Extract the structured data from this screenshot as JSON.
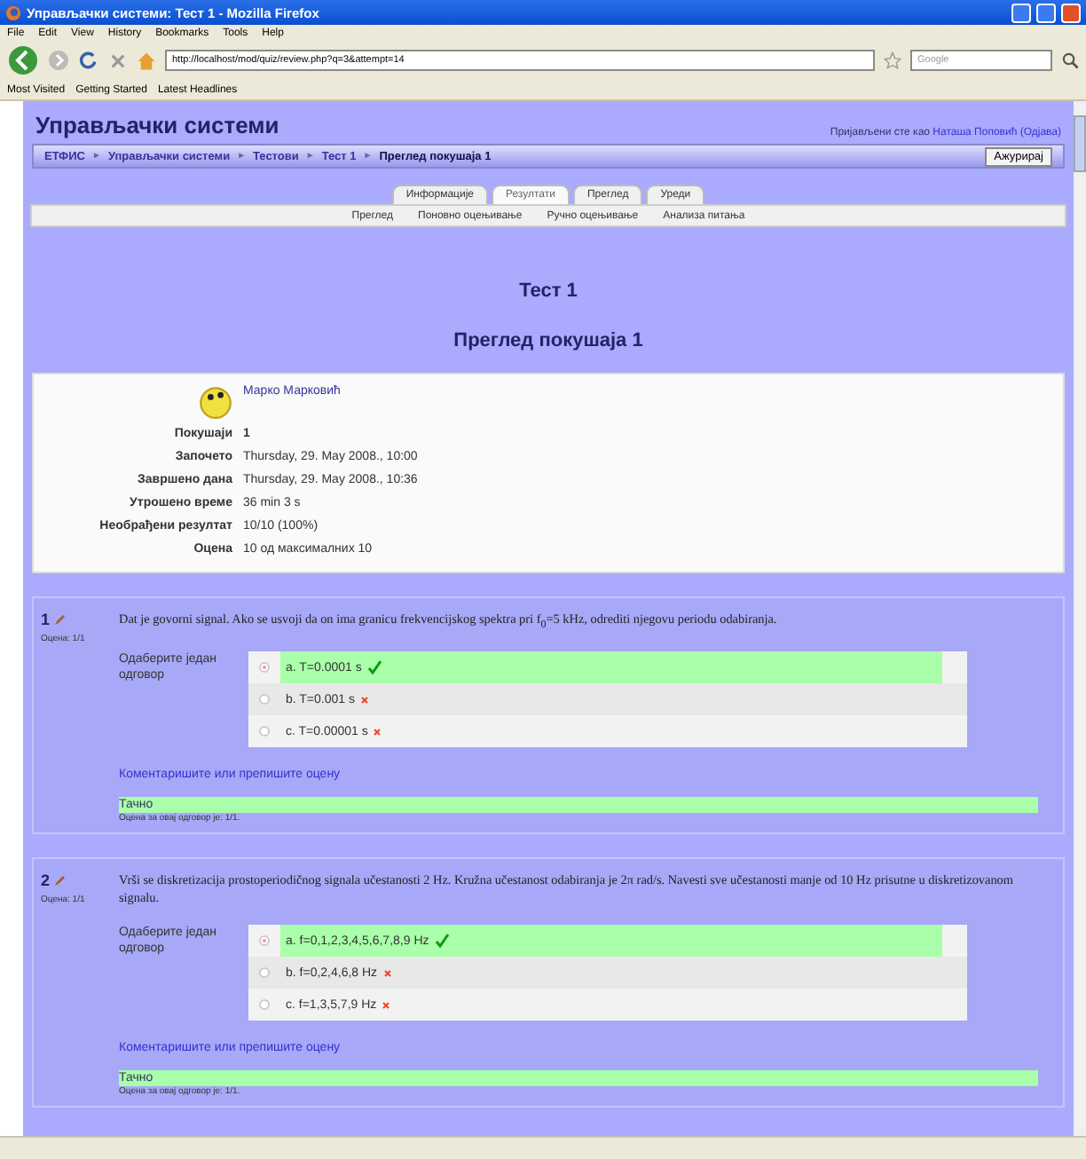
{
  "window": {
    "title": "Управљачки системи: Тест 1 - Mozilla Firefox"
  },
  "menu": [
    "File",
    "Edit",
    "View",
    "History",
    "Bookmarks",
    "Tools",
    "Help"
  ],
  "address": {
    "value": "http://localhost/mod/quiz/review.php?q=3&attempt=14"
  },
  "search": {
    "placeholder": "Google"
  },
  "bookmarks": [
    "Most Visited",
    "Getting Started",
    "Latest Headlines"
  ],
  "header": {
    "site": "Управљачки системи",
    "login_text": "Пријављени сте као",
    "user": "Наташа Поповић",
    "logout": "(Одјава)"
  },
  "breadcrumb": {
    "separator": "►",
    "items": [
      "ЕТФИС",
      "Управљачки системи",
      "Тестови",
      "Тест 1"
    ],
    "current": "Преглед покушаја 1",
    "button": "Ажурирај"
  },
  "tabs": [
    {
      "label": "Информације",
      "selected": false
    },
    {
      "label": "Резултати",
      "selected": true
    },
    {
      "label": "Преглед",
      "selected": false
    },
    {
      "label": "Уреди",
      "selected": false
    }
  ],
  "subtabs": [
    "Преглед",
    "Поновно оцењивање",
    "Ручно оцењивање",
    "Анализа питања"
  ],
  "title": "Тест 1",
  "subtitle": "Преглед покушаја 1",
  "summary": {
    "user": "Марко Марковић",
    "rows": [
      {
        "label": "Покушаји",
        "value": "1",
        "bold": true
      },
      {
        "label": "Започето",
        "value": "Thursday, 29. May 2008., 10:00",
        "bold": false
      },
      {
        "label": "Завршено дана",
        "value": "Thursday, 29. May 2008., 10:36",
        "bold": false
      },
      {
        "label": "Утрошено време",
        "value": "36 min 3 s",
        "bold": false
      },
      {
        "label": "Необрађени резултат",
        "value": "10/10 (100%)",
        "bold": false
      },
      {
        "label": "Оцена",
        "value": "10 од максималних 10",
        "bold": false
      }
    ]
  },
  "questions": [
    {
      "number": "1",
      "grade": "Оцена: 1/1",
      "text": "Dat je govorni signal. Ako se usvoji da on ima granicu frekvencijskog spektra pri f$_{0}$=5 kHz, odrediti njegovu periodu odabiranja.",
      "prompt": "Одаберите један одговор",
      "options": [
        {
          "label": "a. T=0.0001 s",
          "selected": true,
          "correct": true
        },
        {
          "label": "b. T=0.001 s",
          "selected": false,
          "correct": false
        },
        {
          "label": "c. T=0.00001 s",
          "selected": false,
          "correct": false
        }
      ],
      "comment_link": "Коментаришите или препишите оцену",
      "feedback": "Тачно",
      "response_grade": "Оцена за овај одговор је: 1/1."
    },
    {
      "number": "2",
      "grade": "Оцена: 1/1",
      "text": "Vrši se diskretizacija prostoperiodičnog signala učestanosti 2 Hz. Kružna učestanost odabiranja je 2π rad/s. Navesti sve učestanosti manje od 10 Hz prisutne u diskretizovanom signalu.",
      "prompt": "Одаберите један одговор",
      "options": [
        {
          "label": "a. f=0,1,2,3,4,5,6,7,8,9 Hz",
          "selected": true,
          "correct": true
        },
        {
          "label": "b. f=0,2,4,6,8 Hz",
          "selected": false,
          "correct": false
        },
        {
          "label": "c. f=1,3,5,7,9 Hz",
          "selected": false,
          "correct": false
        }
      ],
      "comment_link": "Коментаришите или препишите оцену",
      "feedback": "Тачно",
      "response_grade": "Оцена за овај одговор је: 1/1."
    }
  ]
}
